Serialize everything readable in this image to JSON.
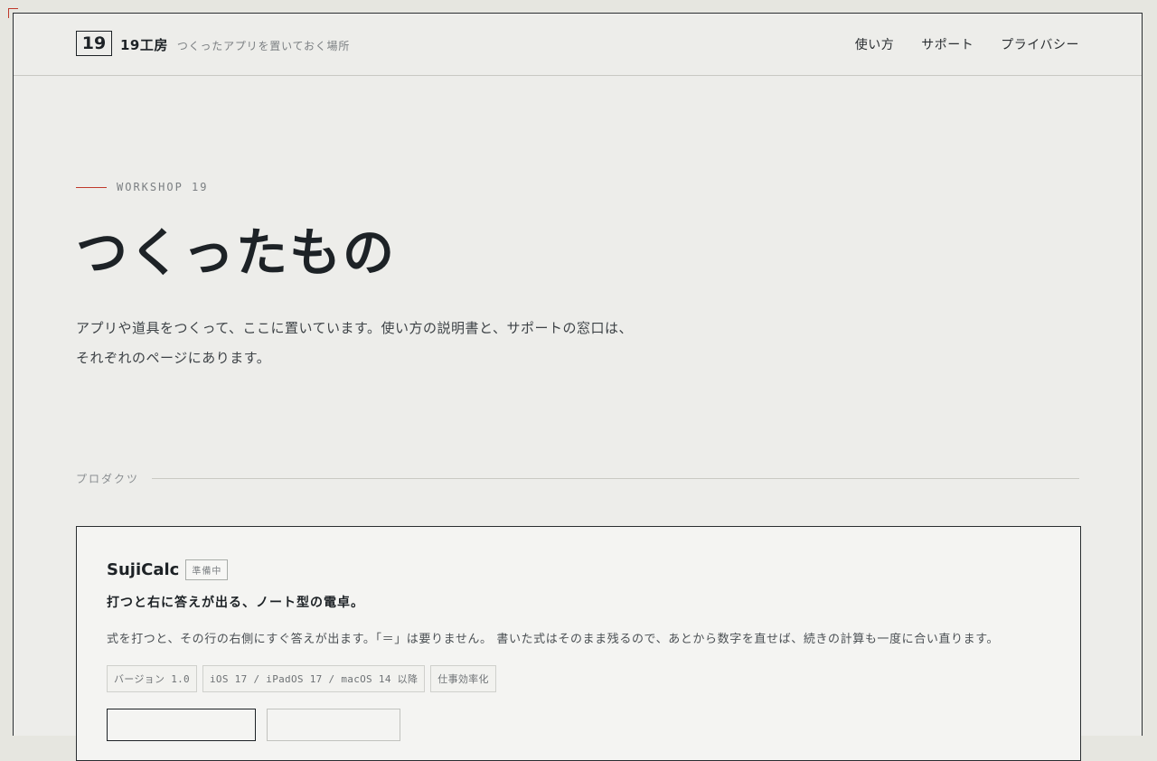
{
  "brand": {
    "logo": "19",
    "name": "19工房",
    "tagline": "つくったアプリを置いておく場所"
  },
  "nav": {
    "items": [
      "使い方",
      "サポート",
      "プライバシー"
    ]
  },
  "hero": {
    "eyebrow": "WORKSHOP 19",
    "title": "つくったもの",
    "description": "アプリや道具をつくって、ここに置いています。使い方の説明書と、サポートの窓口は、それぞれのページにあります。"
  },
  "section": {
    "label": "プロダクツ"
  },
  "product": {
    "name": "SujiCalc",
    "badge": "準備中",
    "tagline": "打つと右に答えが出る、ノート型の電卓。",
    "description": "式を打つと、その行の右側にすぐ答えが出ます。「＝」は要りません。 書いた式はそのまま残るので、あとから数字を直せば、続きの計算も一度に合い直ります。",
    "tags": [
      "バージョン 1.0",
      "iOS 17 / iPadOS 17 / macOS 14 以降",
      "仕事効率化"
    ]
  },
  "colors": {
    "accent": "#c0392b",
    "background": "#ededea",
    "text": "#1d2226"
  }
}
